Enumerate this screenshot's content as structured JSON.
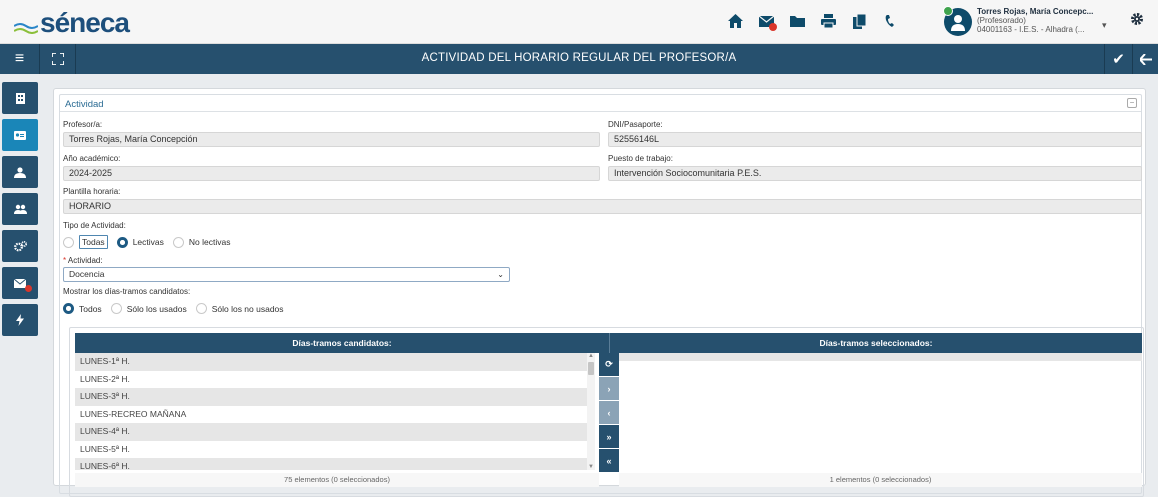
{
  "app": {
    "logo": "séneca"
  },
  "topbar": {
    "icons": [
      "home-icon",
      "mail-icon",
      "folder-icon",
      "print-icon",
      "copy-icon",
      "phone-icon"
    ],
    "user": {
      "name": "Torres Rojas, María Concepc...",
      "role": "(Profesorado)",
      "center": "04001163 - I.E.S. - Alhadra (..."
    }
  },
  "titlebar": {
    "title": "ACTIVIDAD DEL HORARIO REGULAR DEL PROFESOR/A"
  },
  "sidebar": {
    "items": [
      "building-icon",
      "id-card-icon",
      "users-icon",
      "group-icon",
      "cogs-icon",
      "mail-icon",
      "bolt-icon"
    ]
  },
  "form": {
    "section_title": "Actividad",
    "profesor_label": "Profesor/a:",
    "profesor_value": "Torres Rojas, María Concepción",
    "dni_label": "DNI/Pasaporte:",
    "dni_value": "52556146L",
    "anio_label": "Año académico:",
    "anio_value": "2024-2025",
    "puesto_label": "Puesto de trabajo:",
    "puesto_value": "Intervención Sociocomunitaria P.E.S.",
    "plantilla_label": "Plantilla horaria:",
    "plantilla_value": "HORARIO",
    "tipo_label": "Tipo de Actividad:",
    "tipo_options": [
      "Todas",
      "Lectivas",
      "No lectivas"
    ],
    "tipo_selected": "Lectivas",
    "actividad_label": "Actividad:",
    "actividad_required": "*",
    "actividad_value": "Docencia",
    "mostrar_label": "Mostrar los días-tramos candidatos:",
    "mostrar_options": [
      "Todos",
      "Sólo los usados",
      "Sólo los no usados"
    ],
    "mostrar_selected": "Todos"
  },
  "dual_list": {
    "left_header": "Días-tramos candidatos:",
    "right_header": "Días-tramos seleccionados:",
    "left_items": [
      "LUNES-1ª H.",
      "LUNES-2ª H.",
      "LUNES-3ª H.",
      "LUNES-RECREO MAÑANA",
      "LUNES-4ª H.",
      "LUNES-5ª H.",
      "LUNES-6ª H."
    ],
    "left_footer": "75 elementos (0 seleccionados)",
    "right_footer": "1 elementos (0 seleccionados)",
    "buttons": [
      "refresh-icon",
      "move-right-icon",
      "move-left-icon",
      "move-all-right-icon",
      "move-all-left-icon"
    ]
  },
  "colors": {
    "primary": "#26506e",
    "active": "#1a86b8",
    "badge": "#d9362b"
  }
}
